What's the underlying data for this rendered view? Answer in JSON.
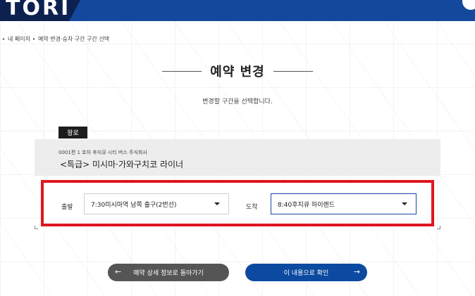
{
  "header": {
    "logo_text": "TORI",
    "brand_color": "#13489c",
    "logo_bg": "#0c2150"
  },
  "breadcrumb": {
    "items": [
      "내 페이지",
      "예약 변경·승차 구간 구간 선택"
    ],
    "separator": "▸"
  },
  "page": {
    "title": "예약 변경",
    "subtitle": "변경할 구간을 선택합니다."
  },
  "route": {
    "tag": "왕로",
    "bus_info": "0001편 1 호차 후지큐 시티 버스 주식회사",
    "route_name": "<특급> 미시마·가와구치코 라이너",
    "departure": {
      "label": "출발",
      "selected": "7:30미시마역 남쪽 출구(2번선)"
    },
    "arrival": {
      "label": "도착",
      "selected": "8:40후지큐 하이랜드"
    },
    "highlight_color": "#e0161e"
  },
  "actions": {
    "back_label": "예약 상세 정보로 돌아가기",
    "confirm_label": "이 내용으로 확인",
    "back_arrow": "←",
    "confirm_arrow": "→"
  }
}
